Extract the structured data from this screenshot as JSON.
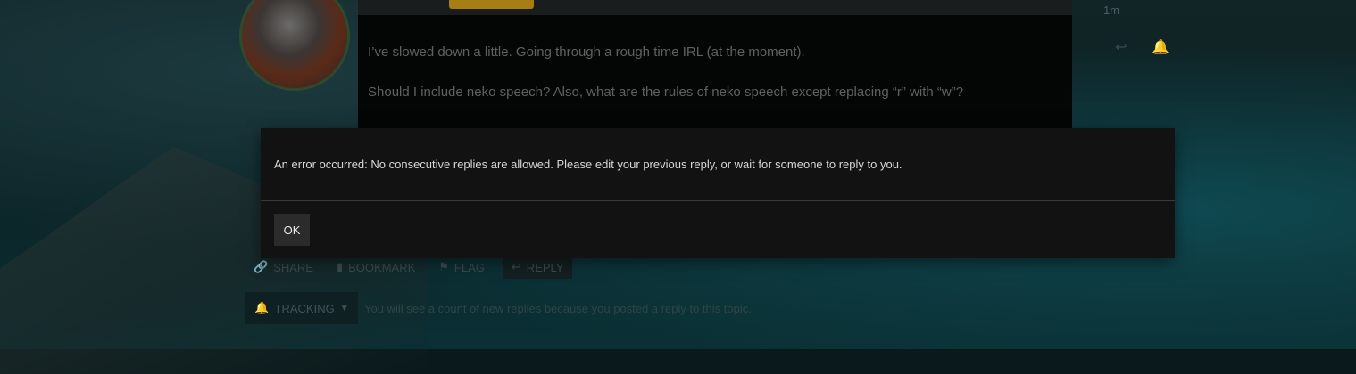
{
  "post": {
    "badge_label": "",
    "meta_text": "",
    "paragraph_1": "I’ve slowed down a little. Going through a rough time IRL (at the moment).",
    "paragraph_2": "Should I include neko speech? Also, what are the rules of neko speech except replacing “r” with “w”?",
    "time": "1m"
  },
  "actions": {
    "share": "SHARE",
    "bookmark": "BOOKMARK",
    "flag": "FLAG",
    "reply": "REPLY"
  },
  "tracking": {
    "label": "TRACKING",
    "description": "You will see a count of new replies because you posted a reply to this topic."
  },
  "modal": {
    "message": "An error occurred: No consecutive replies are allowed. Please edit your previous reply, or wait for someone to reply to you.",
    "ok_label": "OK"
  },
  "icons": {
    "share": "link-icon",
    "bookmark": "bookmark-icon",
    "flag": "flag-icon",
    "reply": "reply-icon",
    "bell": "bell-icon",
    "caret": "caret-down-icon"
  },
  "colors": {
    "modal_bg": "#121212",
    "badge": "#a77e14",
    "bell": "#2f5d77"
  }
}
